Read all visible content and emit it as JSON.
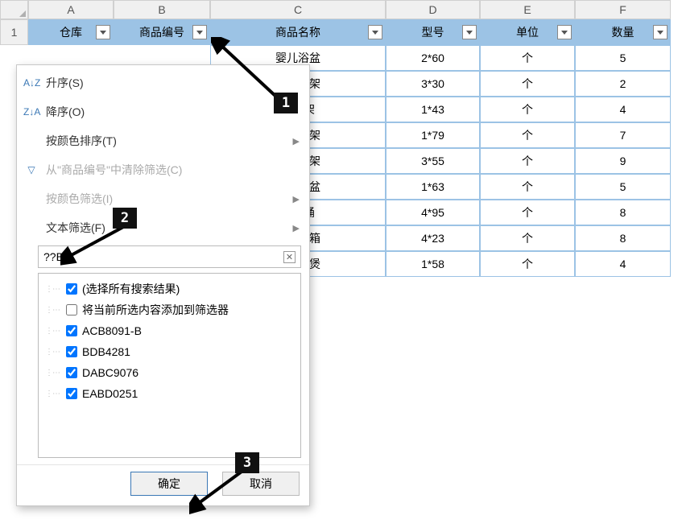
{
  "columns": [
    "A",
    "B",
    "C",
    "D",
    "E",
    "F"
  ],
  "rownum": "1",
  "headers": {
    "A": "仓库",
    "B": "商品编号",
    "C": "商品名称",
    "D": "型号",
    "E": "单位",
    "F": "数量"
  },
  "rows": [
    {
      "C": "婴儿浴盆",
      "D": "2*60",
      "E": "个",
      "F": "5"
    },
    {
      "C": "型四方架",
      "D": "3*30",
      "E": "个",
      "F": "2"
    },
    {
      "C": "架鞋架",
      "D": "1*43",
      "E": "个",
      "F": "4"
    },
    {
      "C": "层三脚架",
      "D": "1*79",
      "E": "个",
      "F": "7"
    },
    {
      "C": "型四方架",
      "D": "3*55",
      "E": "个",
      "F": "9"
    },
    {
      "C": "婴儿浴盆",
      "D": "1*63",
      "E": "个",
      "F": "5"
    },
    {
      "C": "通用桶",
      "D": "4*95",
      "E": "个",
      "F": "8"
    },
    {
      "C": "保健药箱",
      "D": "4*23",
      "E": "个",
      "F": "8"
    },
    {
      "C": "号专用煲",
      "D": "1*58",
      "E": "个",
      "F": "4"
    }
  ],
  "menu": {
    "sort_asc": "升序(S)",
    "sort_desc": "降序(O)",
    "sort_color": "按颜色排序(T)",
    "clear_filter": "从\"商品编号\"中清除筛选(C)",
    "filter_color": "按颜色筛选(I)",
    "text_filter": "文本筛选(F)"
  },
  "search_value": "??B*",
  "checklist": [
    {
      "label": "(选择所有搜索结果)",
      "checked": true
    },
    {
      "label": "将当前所选内容添加到筛选器",
      "checked": false
    },
    {
      "label": "ACB8091-B",
      "checked": true
    },
    {
      "label": "BDB4281",
      "checked": true
    },
    {
      "label": "DABC9076",
      "checked": true
    },
    {
      "label": "EABD0251",
      "checked": true
    }
  ],
  "buttons": {
    "ok": "确定",
    "cancel": "取消"
  },
  "callouts": {
    "c1": "1",
    "c2": "2",
    "c3": "3"
  },
  "icons": {
    "sort_asc": "A↓Z",
    "sort_desc": "Z↓A",
    "funnel": "▽"
  }
}
